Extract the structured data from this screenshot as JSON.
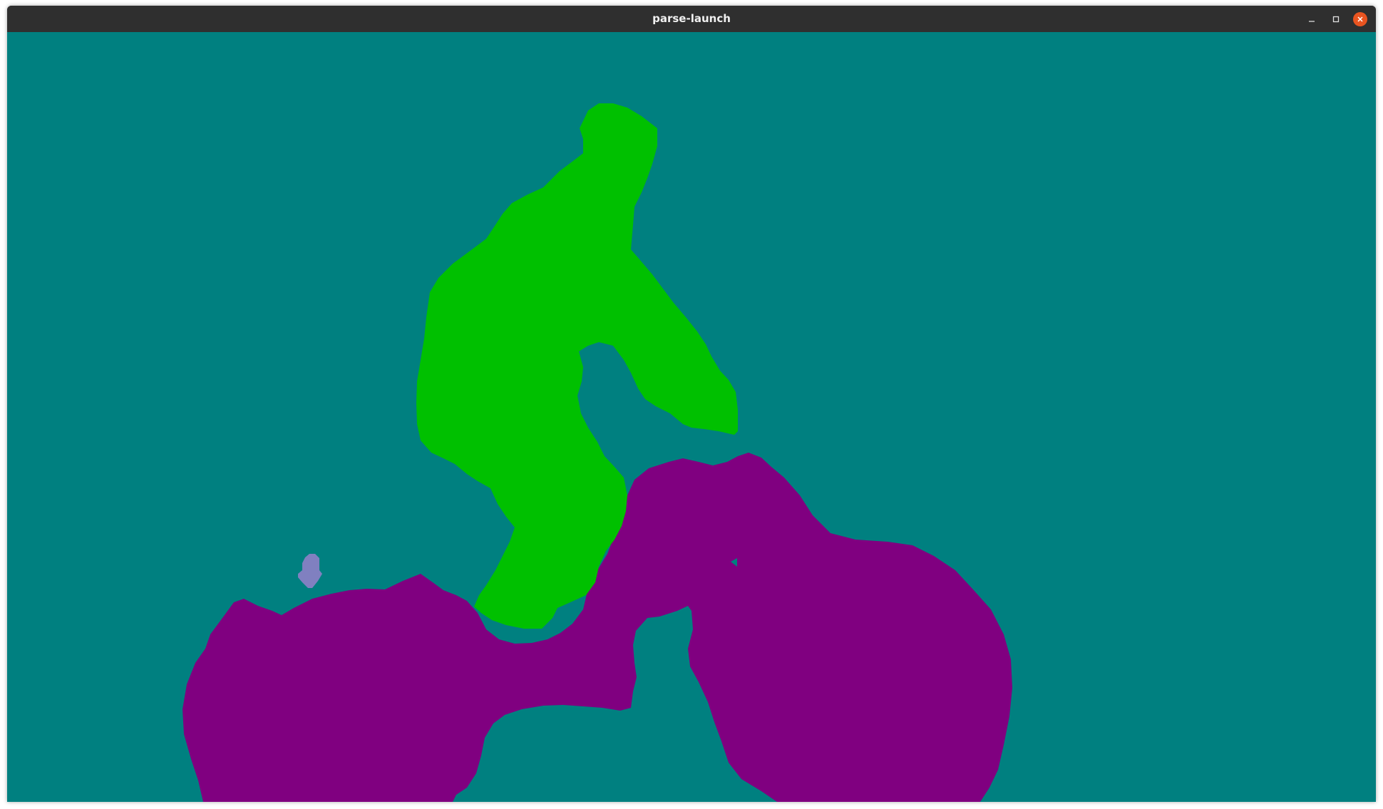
{
  "window": {
    "title": "parse-launch",
    "controls": {
      "minimize_icon": "minimize-icon",
      "maximize_icon": "maximize-icon",
      "close_icon": "close-icon"
    }
  },
  "colors": {
    "titlebar": "#2f2f2f",
    "title_text": "#f0f0f0",
    "close_button": "#e95420",
    "background": "#008080",
    "person": "#00c000",
    "bicycle": "#800080",
    "small_object": "#8080c0"
  },
  "segmentation": {
    "regions": [
      "background",
      "person",
      "bicycle",
      "small-object"
    ]
  }
}
